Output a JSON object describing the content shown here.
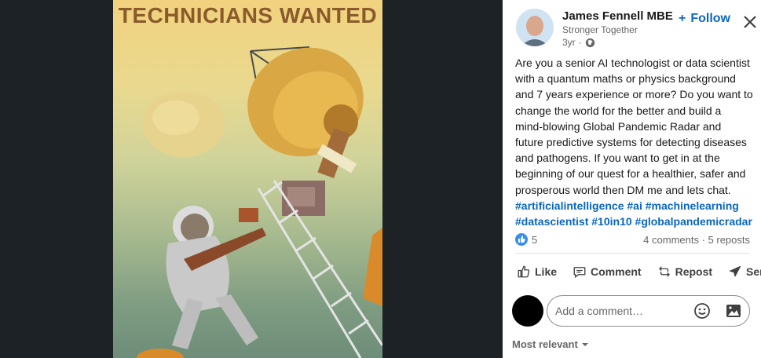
{
  "poster": {
    "title": "TECHNICIANS WANTED"
  },
  "post": {
    "author": "James Fennell MBE",
    "subtitle": "Stronger Together",
    "age": "3yr",
    "follow_label": "Follow",
    "body_lines": [
      "Are you a senior AI technologist or data scientist",
      "with a quantum maths or physics background",
      "and 7 years experience or more? Do you want to",
      "change the world for the better and build a",
      "mind-blowing Global Pandemic Radar and",
      "future predictive systems for detecting diseases",
      "and pathogens. If you want to get in at the",
      "beginning of our quest for a healthier, safer and",
      "prosperous world then DM me and lets chat."
    ],
    "hashtags_line1": [
      "#artificialintelligence",
      "#ai",
      "#machinelearning"
    ],
    "hashtags_line2": [
      "#datascientist",
      "#10in10",
      "#globalpandemicradar"
    ],
    "reaction_count": "5",
    "comments_reposts": "4 comments · 5 reposts"
  },
  "actions": {
    "like": "Like",
    "comment": "Comment",
    "repost": "Repost",
    "send": "Send"
  },
  "comment_input": {
    "placeholder": "Add a comment…"
  },
  "sort": {
    "label": "Most relevant"
  },
  "colors": {
    "accent": "#0a66c2",
    "panel_bg": "#ffffff",
    "viewer_bg": "#1d2226"
  }
}
